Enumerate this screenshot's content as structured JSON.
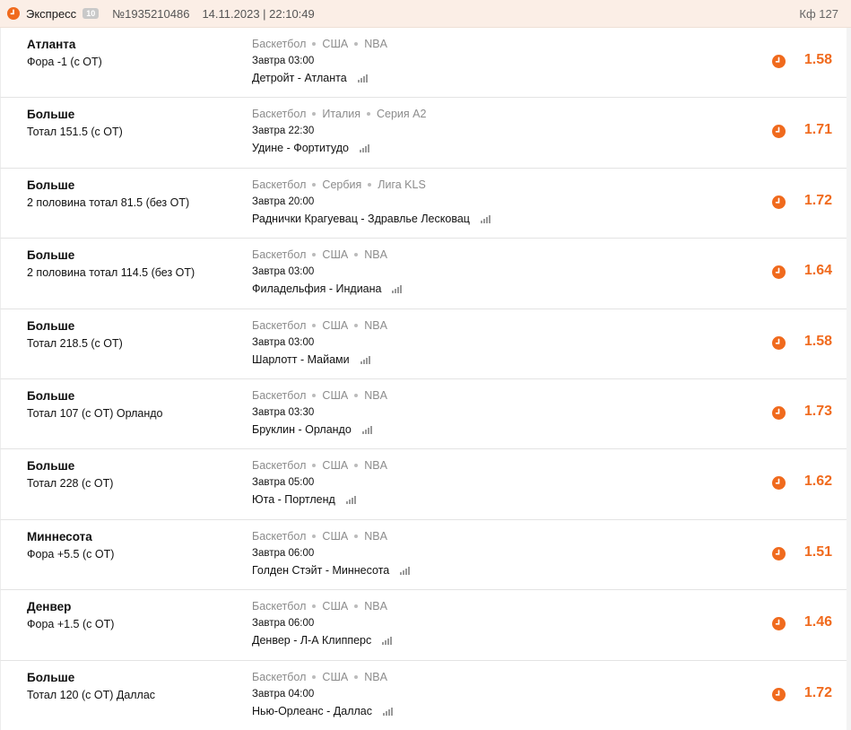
{
  "header": {
    "title": "Экспресс",
    "badge": "10",
    "bet_number": "№1935210486",
    "datetime": "14.11.2023 | 22:10:49",
    "coefficient": "Кф 127"
  },
  "colors": {
    "accent": "#f06a1d",
    "header_bg": "#fbeee6"
  },
  "bets": [
    {
      "team": "Атланта",
      "market": "Фора -1 (с ОТ)",
      "sport": "Баскетбол",
      "country": "США",
      "league": "NBA",
      "time": "Завтра 03:00",
      "match": "Детройт - Атланта",
      "odds": "1.58"
    },
    {
      "team": "Больше",
      "market": "Тотал 151.5 (с ОТ)",
      "sport": "Баскетбол",
      "country": "Италия",
      "league": "Серия А2",
      "time": "Завтра 22:30",
      "match": "Удине - Фортитудо",
      "odds": "1.71"
    },
    {
      "team": "Больше",
      "market": "2 половина тотал 81.5 (без ОТ)",
      "sport": "Баскетбол",
      "country": "Сербия",
      "league": "Лига KLS",
      "time": "Завтра 20:00",
      "match": "Раднички Крагуевац - Здравлье Лесковац",
      "odds": "1.72"
    },
    {
      "team": "Больше",
      "market": "2 половина тотал 114.5 (без ОТ)",
      "sport": "Баскетбол",
      "country": "США",
      "league": "NBA",
      "time": "Завтра 03:00",
      "match": "Филадельфия - Индиана",
      "odds": "1.64"
    },
    {
      "team": "Больше",
      "market": "Тотал 218.5 (с ОТ)",
      "sport": "Баскетбол",
      "country": "США",
      "league": "NBA",
      "time": "Завтра 03:00",
      "match": "Шарлотт - Майами",
      "odds": "1.58"
    },
    {
      "team": "Больше",
      "market": "Тотал 107 (с ОТ) Орландо",
      "sport": "Баскетбол",
      "country": "США",
      "league": "NBA",
      "time": "Завтра 03:30",
      "match": "Бруклин - Орландо",
      "odds": "1.73"
    },
    {
      "team": "Больше",
      "market": "Тотал 228 (с ОТ)",
      "sport": "Баскетбол",
      "country": "США",
      "league": "NBA",
      "time": "Завтра 05:00",
      "match": "Юта - Портленд",
      "odds": "1.62"
    },
    {
      "team": "Миннесота",
      "market": "Фора +5.5 (с ОТ)",
      "sport": "Баскетбол",
      "country": "США",
      "league": "NBA",
      "time": "Завтра 06:00",
      "match": "Голден Стэйт - Миннесота",
      "odds": "1.51"
    },
    {
      "team": "Денвер",
      "market": "Фора +1.5 (с ОТ)",
      "sport": "Баскетбол",
      "country": "США",
      "league": "NBA",
      "time": "Завтра 06:00",
      "match": "Денвер - Л-А Клипперс",
      "odds": "1.46"
    },
    {
      "team": "Больше",
      "market": "Тотал 120 (с ОТ) Даллас",
      "sport": "Баскетбол",
      "country": "США",
      "league": "NBA",
      "time": "Завтра 04:00",
      "match": "Нью-Орлеанс - Даллас",
      "odds": "1.72"
    }
  ]
}
